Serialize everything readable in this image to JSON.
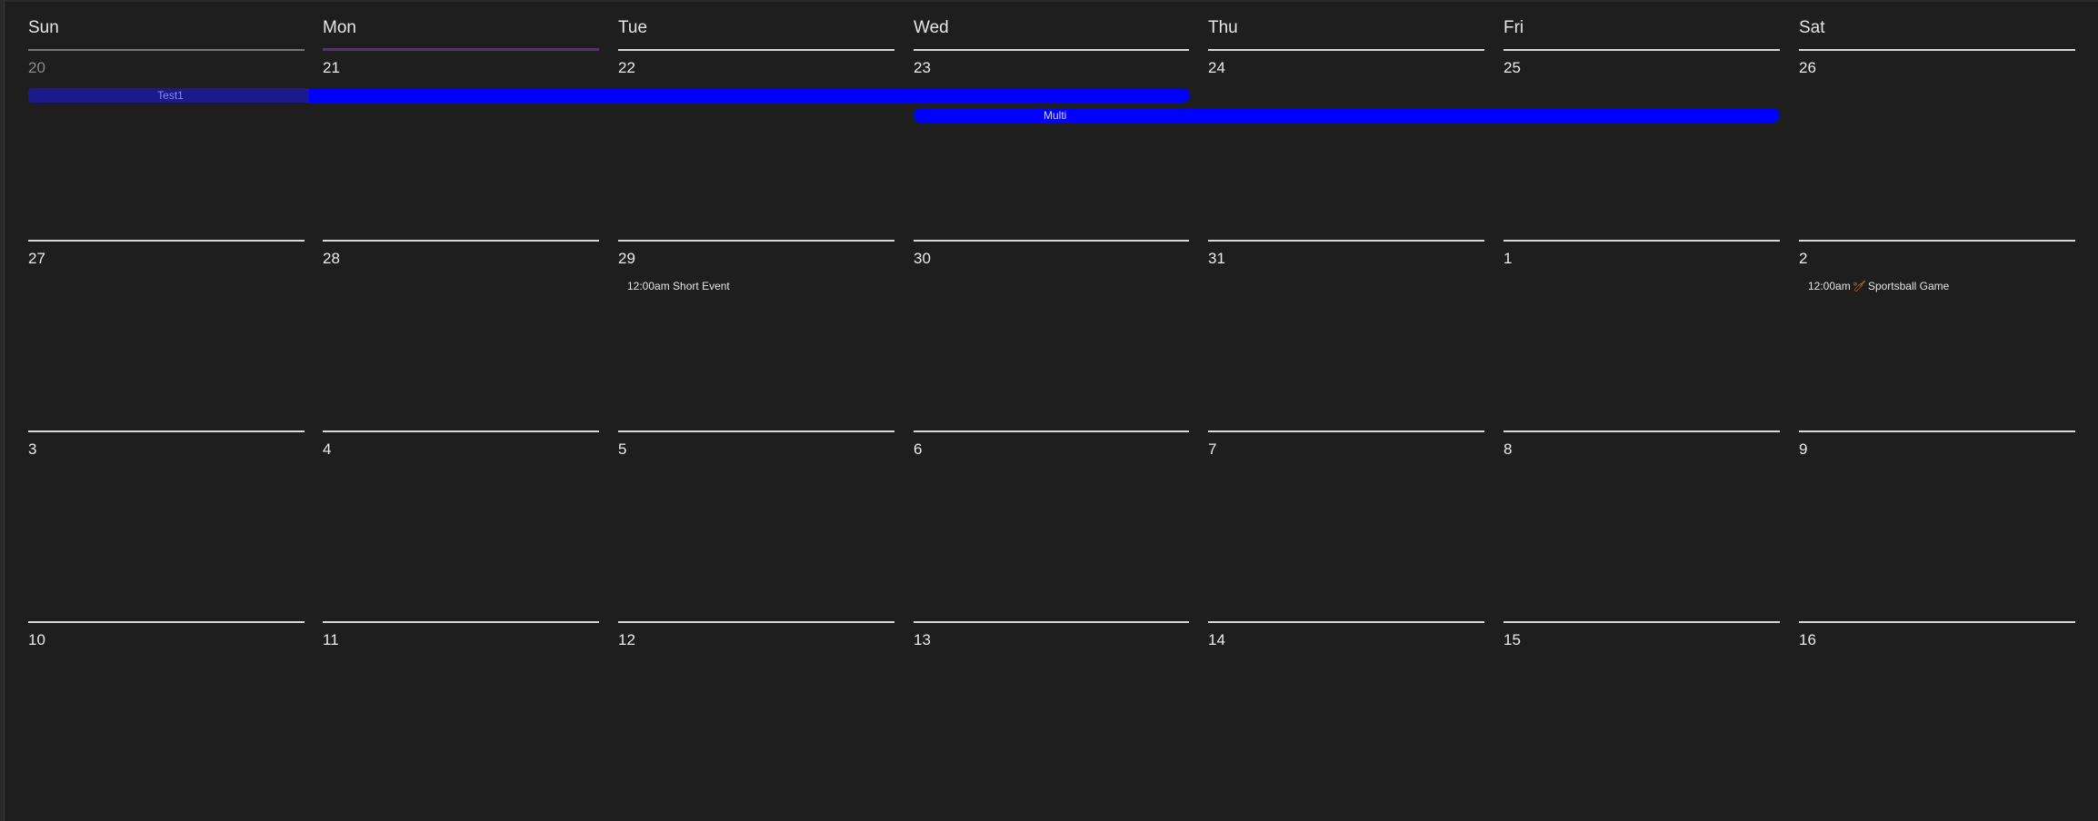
{
  "weekdays": [
    "Sun",
    "Mon",
    "Tue",
    "Wed",
    "Thu",
    "Fri",
    "Sat"
  ],
  "weeks": [
    [
      "20",
      "21",
      "22",
      "23",
      "24",
      "25",
      "26"
    ],
    [
      "27",
      "28",
      "29",
      "30",
      "31",
      "1",
      "2"
    ],
    [
      "3",
      "4",
      "5",
      "6",
      "7",
      "8",
      "9"
    ],
    [
      "10",
      "11",
      "12",
      "13",
      "14",
      "15",
      "16"
    ]
  ],
  "events": {
    "test1": {
      "label": "Test1",
      "color": "#0000ff",
      "faded_color": "#1b1a8c"
    },
    "multi": {
      "label": "Multi",
      "color": "#0000ff"
    },
    "short_event": {
      "time": "12:00am",
      "label": "Short Event"
    },
    "sportsball": {
      "time": "12:00am",
      "label": "Sportsball Game",
      "icon": "baseball-bat-icon"
    }
  },
  "colors": {
    "background": "#1e1e1e",
    "today_underline": "#5b2b82",
    "event_blue": "#0000ff"
  }
}
